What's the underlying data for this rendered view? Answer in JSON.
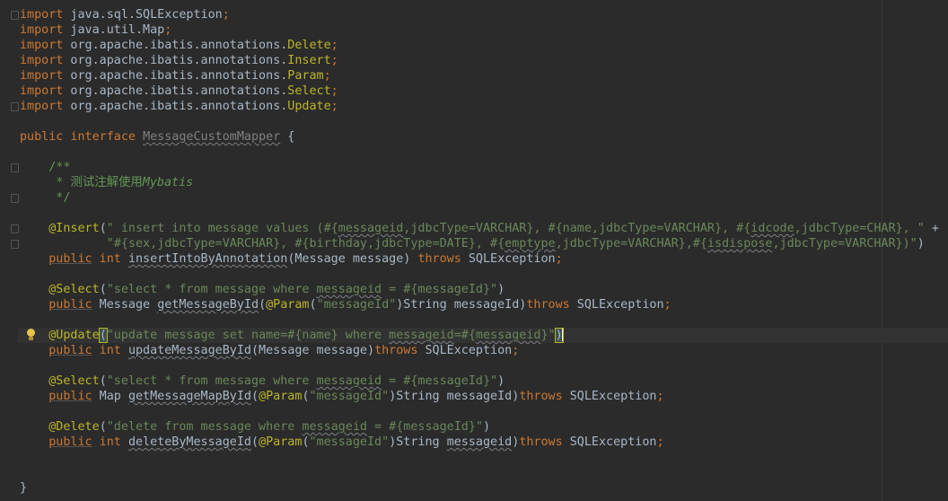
{
  "editor": {
    "lines": [
      {
        "tokens": [
          {
            "t": "import",
            "c": "kw"
          },
          {
            "t": " java.sql.SQLException",
            "c": "plain"
          },
          {
            "t": ";",
            "c": "kw"
          }
        ]
      },
      {
        "tokens": [
          {
            "t": "import",
            "c": "kw"
          },
          {
            "t": " java.util.Map",
            "c": "plain"
          },
          {
            "t": ";",
            "c": "kw"
          }
        ]
      },
      {
        "tokens": [
          {
            "t": "import",
            "c": "kw"
          },
          {
            "t": " org.apache.ibatis.annotations.",
            "c": "plain"
          },
          {
            "t": "Delete",
            "c": "ann"
          },
          {
            "t": ";",
            "c": "kw"
          }
        ]
      },
      {
        "tokens": [
          {
            "t": "import",
            "c": "kw"
          },
          {
            "t": " org.apache.ibatis.annotations.",
            "c": "plain"
          },
          {
            "t": "Insert",
            "c": "ann"
          },
          {
            "t": ";",
            "c": "kw"
          }
        ]
      },
      {
        "tokens": [
          {
            "t": "import",
            "c": "kw"
          },
          {
            "t": " org.apache.ibatis.annotations.",
            "c": "plain"
          },
          {
            "t": "Param",
            "c": "ann"
          },
          {
            "t": ";",
            "c": "kw"
          }
        ]
      },
      {
        "tokens": [
          {
            "t": "import",
            "c": "kw"
          },
          {
            "t": " org.apache.ibatis.annotations.",
            "c": "plain"
          },
          {
            "t": "Select",
            "c": "ann"
          },
          {
            "t": ";",
            "c": "kw"
          }
        ]
      },
      {
        "tokens": [
          {
            "t": "import",
            "c": "kw"
          },
          {
            "t": " org.apache.ibatis.annotations.",
            "c": "plain"
          },
          {
            "t": "Update",
            "c": "ann"
          },
          {
            "t": ";",
            "c": "kw"
          }
        ]
      },
      {
        "tokens": []
      },
      {
        "tokens": [
          {
            "t": "public interface ",
            "c": "kw"
          },
          {
            "t": "MessageCustomMapper",
            "c": "unused typo"
          },
          {
            "t": " {",
            "c": "plain"
          }
        ]
      },
      {
        "tokens": []
      },
      {
        "tokens": [
          {
            "t": "    /**",
            "c": "cmt"
          }
        ]
      },
      {
        "tokens": [
          {
            "t": "     * 测试注解使用",
            "c": "cmt"
          },
          {
            "t": "Mybatis",
            "c": "cmt-i"
          }
        ]
      },
      {
        "tokens": [
          {
            "t": "     */",
            "c": "cmt"
          }
        ]
      },
      {
        "tokens": []
      },
      {
        "tokens": [
          {
            "t": "    @Insert",
            "c": "ann"
          },
          {
            "t": "(",
            "c": "plain"
          },
          {
            "t": "\" insert into message values (#{",
            "c": "str"
          },
          {
            "t": "messageid",
            "c": "str typo"
          },
          {
            "t": ",jdbcType=VARCHAR}, #{name,jdbcType=VARCHAR}, #{",
            "c": "str"
          },
          {
            "t": "idcode",
            "c": "str typo"
          },
          {
            "t": ",jdbcType=CHAR}, \"",
            "c": "str"
          },
          {
            "t": " +",
            "c": "plain"
          }
        ]
      },
      {
        "tokens": [
          {
            "t": "            \"#{sex,jdbcType=VARCHAR}, #{birthday,jdbcType=DATE}, #{",
            "c": "str"
          },
          {
            "t": "emptype",
            "c": "str typo"
          },
          {
            "t": ",jdbcType=VARCHAR},#{",
            "c": "str"
          },
          {
            "t": "isdispose",
            "c": "str typo"
          },
          {
            "t": ",jdbcType=VARCHAR})\"",
            "c": "str"
          },
          {
            "t": ")",
            "c": "plain"
          }
        ]
      },
      {
        "tokens": [
          {
            "t": "    ",
            "c": "plain"
          },
          {
            "t": "public",
            "c": "kw warn-u"
          },
          {
            "t": " int ",
            "c": "kw"
          },
          {
            "t": "insertIntoByAnnotation",
            "c": "fn typo"
          },
          {
            "t": "(Message message) ",
            "c": "plain"
          },
          {
            "t": "throws",
            "c": "kw"
          },
          {
            "t": " SQLException",
            "c": "plain"
          },
          {
            "t": ";",
            "c": "kw"
          }
        ]
      },
      {
        "tokens": []
      },
      {
        "tokens": [
          {
            "t": "    @Select",
            "c": "ann"
          },
          {
            "t": "(",
            "c": "plain"
          },
          {
            "t": "\"select * from message where ",
            "c": "str"
          },
          {
            "t": "messageid",
            "c": "str typo"
          },
          {
            "t": " = #{messageId}\"",
            "c": "str"
          },
          {
            "t": ")",
            "c": "plain"
          }
        ]
      },
      {
        "tokens": [
          {
            "t": "    ",
            "c": "plain"
          },
          {
            "t": "public",
            "c": "kw warn-u"
          },
          {
            "t": " Message ",
            "c": "plain"
          },
          {
            "t": "getMessageById",
            "c": "fn typo"
          },
          {
            "t": "(",
            "c": "plain"
          },
          {
            "t": "@Param",
            "c": "ann"
          },
          {
            "t": "(",
            "c": "plain"
          },
          {
            "t": "\"messageId\"",
            "c": "str"
          },
          {
            "t": ")String messageId)",
            "c": "plain"
          },
          {
            "t": "throws",
            "c": "kw"
          },
          {
            "t": " SQLException",
            "c": "plain"
          },
          {
            "t": ";",
            "c": "kw"
          }
        ]
      },
      {
        "tokens": []
      },
      {
        "tokens": [
          {
            "t": "    @Update",
            "c": "ann"
          },
          {
            "t": "(",
            "c": "plain brace-match"
          },
          {
            "t": "\"update message set name=#{name} where ",
            "c": "str"
          },
          {
            "t": "messageid",
            "c": "str typo"
          },
          {
            "t": "=#{",
            "c": "str"
          },
          {
            "t": "messageid",
            "c": "str typo"
          },
          {
            "t": "}\"",
            "c": "str"
          },
          {
            "t": ")",
            "c": "plain brace-match"
          },
          {
            "t": "",
            "c": "caret"
          }
        ]
      },
      {
        "tokens": [
          {
            "t": "    ",
            "c": "plain"
          },
          {
            "t": "public",
            "c": "kw warn-u"
          },
          {
            "t": " int ",
            "c": "kw"
          },
          {
            "t": "updateMessageById",
            "c": "fn typo"
          },
          {
            "t": "(Message message)",
            "c": "plain"
          },
          {
            "t": "throws",
            "c": "kw"
          },
          {
            "t": " SQLException",
            "c": "plain"
          },
          {
            "t": ";",
            "c": "kw"
          }
        ]
      },
      {
        "tokens": []
      },
      {
        "tokens": [
          {
            "t": "    @Select",
            "c": "ann"
          },
          {
            "t": "(",
            "c": "plain"
          },
          {
            "t": "\"select * from message where ",
            "c": "str"
          },
          {
            "t": "messageid",
            "c": "str typo"
          },
          {
            "t": " = #{messageId}\"",
            "c": "str"
          },
          {
            "t": ")",
            "c": "plain"
          }
        ]
      },
      {
        "tokens": [
          {
            "t": "    ",
            "c": "plain"
          },
          {
            "t": "public",
            "c": "kw warn-u"
          },
          {
            "t": " Map ",
            "c": "plain"
          },
          {
            "t": "getMessageMapById",
            "c": "fn typo"
          },
          {
            "t": "(",
            "c": "plain"
          },
          {
            "t": "@Param",
            "c": "ann"
          },
          {
            "t": "(",
            "c": "plain"
          },
          {
            "t": "\"messageId\"",
            "c": "str"
          },
          {
            "t": ")String messageId)",
            "c": "plain"
          },
          {
            "t": "throws",
            "c": "kw"
          },
          {
            "t": " SQLException",
            "c": "plain"
          },
          {
            "t": ";",
            "c": "kw"
          }
        ]
      },
      {
        "tokens": []
      },
      {
        "tokens": [
          {
            "t": "    @Delete",
            "c": "ann"
          },
          {
            "t": "(",
            "c": "plain"
          },
          {
            "t": "\"delete from message where ",
            "c": "str"
          },
          {
            "t": "messageid",
            "c": "str typo"
          },
          {
            "t": " = #{messageId}\"",
            "c": "str"
          },
          {
            "t": ")",
            "c": "plain"
          }
        ]
      },
      {
        "tokens": [
          {
            "t": "    ",
            "c": "plain"
          },
          {
            "t": "public",
            "c": "kw warn-u"
          },
          {
            "t": " int ",
            "c": "kw"
          },
          {
            "t": "deleteByMessageId",
            "c": "fn typo"
          },
          {
            "t": "(",
            "c": "plain"
          },
          {
            "t": "@Param",
            "c": "ann"
          },
          {
            "t": "(",
            "c": "plain"
          },
          {
            "t": "\"messageId\"",
            "c": "str"
          },
          {
            "t": ")String ",
            "c": "plain"
          },
          {
            "t": "messageid",
            "c": "plain typo"
          },
          {
            "t": ")",
            "c": "plain"
          },
          {
            "t": "throws",
            "c": "kw"
          },
          {
            "t": " SQLException",
            "c": "plain"
          },
          {
            "t": ";",
            "c": "kw"
          }
        ]
      },
      {
        "tokens": []
      },
      {
        "tokens": []
      },
      {
        "tokens": [
          {
            "t": "}",
            "c": "plain"
          }
        ]
      }
    ],
    "icons": {
      "intention": "lightbulb-icon",
      "fold": "fold-marker-icon"
    },
    "colors": {
      "background": "#2b2b2b",
      "keyword": "#cc7832",
      "annotation": "#bbb529",
      "string": "#6a8759",
      "comment": "#629755",
      "text": "#a9b7c6"
    }
  }
}
